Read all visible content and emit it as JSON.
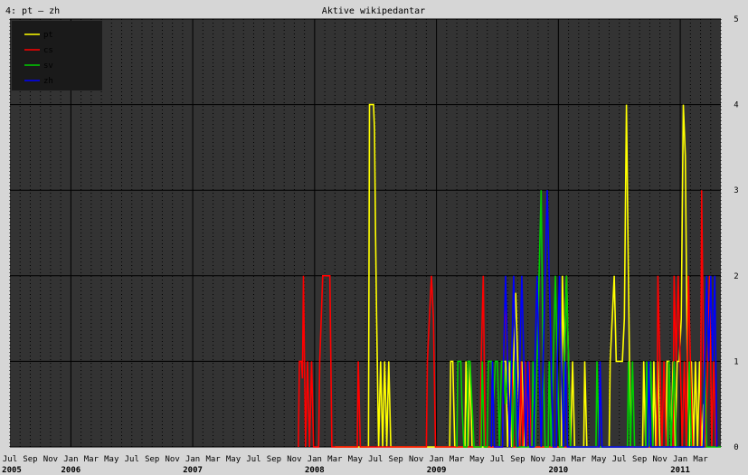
{
  "chart_data": {
    "type": "line",
    "title": "Aktive wikipedantar",
    "corner_label": "4: pt – zh",
    "ylim": [
      0,
      5
    ],
    "yticks": [
      "0",
      "1",
      "2",
      "3",
      "4",
      "5"
    ],
    "x_start": "2005-07",
    "month_ticks": [
      "Jul",
      "Sep",
      "Nov",
      "Jan",
      "Mar",
      "May",
      "Jul",
      "Sep",
      "Nov",
      "Jan",
      "Mar",
      "May",
      "Jul",
      "Sep",
      "Nov",
      "Jan",
      "Mar",
      "May",
      "Jul",
      "Sep",
      "Nov",
      "Jan",
      "Mar",
      "May",
      "Jul",
      "Sep",
      "Nov",
      "Jan",
      "Mar",
      "May",
      "Jul",
      "Sep",
      "Nov",
      "Jan",
      "Mar"
    ],
    "year_labels": [
      {
        "label": "2005",
        "month_index": 0
      },
      {
        "label": "2006",
        "month_index": 6
      },
      {
        "label": "2007",
        "month_index": 18
      },
      {
        "label": "2008",
        "month_index": 30
      },
      {
        "label": "2009",
        "month_index": 42
      },
      {
        "label": "2010",
        "month_index": 54
      },
      {
        "label": "2011",
        "month_index": 66
      }
    ],
    "x_months_span": 70,
    "grid": true,
    "legend_position": "top-left",
    "colors": {
      "background": "#333333",
      "grid": "#000000",
      "frame": "#d6d6d6"
    },
    "series": [
      {
        "name": "pt",
        "color": "#ffff00",
        "points": [
          [
            32.0,
            0
          ],
          [
            35.3,
            0
          ],
          [
            35.4,
            4
          ],
          [
            35.8,
            4
          ],
          [
            35.9,
            3.7
          ],
          [
            36.0,
            2.5
          ],
          [
            36.1,
            1.5
          ],
          [
            36.3,
            0
          ],
          [
            36.5,
            1
          ],
          [
            36.7,
            0
          ],
          [
            36.9,
            1
          ],
          [
            37.1,
            0
          ],
          [
            37.3,
            1
          ],
          [
            37.5,
            0
          ],
          [
            43.3,
            0
          ],
          [
            43.4,
            1
          ],
          [
            43.6,
            1
          ],
          [
            43.8,
            0
          ],
          [
            44.8,
            0
          ],
          [
            44.9,
            1
          ],
          [
            45.1,
            0
          ],
          [
            45.3,
            1
          ],
          [
            45.5,
            0
          ],
          [
            48.5,
            0
          ],
          [
            48.6,
            1
          ],
          [
            48.8,
            1
          ],
          [
            49.0,
            0
          ],
          [
            49.2,
            1
          ],
          [
            49.4,
            0
          ],
          [
            49.6,
            1
          ],
          [
            49.8,
            1.8
          ],
          [
            50.0,
            1
          ],
          [
            50.2,
            0
          ],
          [
            50.4,
            1
          ],
          [
            50.6,
            0
          ],
          [
            54.3,
            0
          ],
          [
            54.4,
            2
          ],
          [
            54.6,
            1
          ],
          [
            54.8,
            2
          ],
          [
            55.0,
            1
          ],
          [
            55.2,
            0
          ],
          [
            55.4,
            1
          ],
          [
            55.6,
            0
          ],
          [
            56.5,
            0
          ],
          [
            56.6,
            1
          ],
          [
            56.8,
            0
          ],
          [
            59.0,
            0
          ],
          [
            59.1,
            1
          ],
          [
            59.3,
            1.5
          ],
          [
            59.5,
            2
          ],
          [
            59.7,
            1
          ],
          [
            59.9,
            1
          ],
          [
            60.1,
            1
          ],
          [
            60.3,
            1
          ],
          [
            60.5,
            1.5
          ],
          [
            60.7,
            4
          ],
          [
            60.9,
            2
          ],
          [
            61.1,
            0
          ],
          [
            62.3,
            0
          ],
          [
            62.4,
            1
          ],
          [
            62.6,
            0
          ],
          [
            63.3,
            0
          ],
          [
            63.4,
            1
          ],
          [
            63.6,
            0
          ],
          [
            63.8,
            1
          ],
          [
            64.0,
            0
          ],
          [
            64.6,
            0
          ],
          [
            64.7,
            1
          ],
          [
            64.9,
            1
          ],
          [
            65.1,
            0
          ],
          [
            65.3,
            1
          ],
          [
            65.5,
            0
          ],
          [
            65.7,
            1
          ],
          [
            65.9,
            1
          ],
          [
            66.1,
            1.5
          ],
          [
            66.3,
            4
          ],
          [
            66.5,
            3.4
          ],
          [
            66.7,
            1
          ],
          [
            66.9,
            0
          ],
          [
            67.1,
            1
          ],
          [
            67.3,
            0
          ],
          [
            67.5,
            1
          ],
          [
            67.7,
            0
          ],
          [
            67.9,
            1
          ],
          [
            68.1,
            0
          ],
          [
            68.3,
            0.5
          ],
          [
            68.5,
            0
          ]
        ]
      },
      {
        "name": "cs",
        "color": "#ff0000",
        "points": [
          [
            28.4,
            0
          ],
          [
            28.5,
            1
          ],
          [
            28.7,
            1
          ],
          [
            28.8,
            0.8
          ],
          [
            28.9,
            2
          ],
          [
            29.1,
            0
          ],
          [
            29.3,
            1
          ],
          [
            29.5,
            0
          ],
          [
            29.7,
            1
          ],
          [
            29.9,
            0
          ],
          [
            30.4,
            0
          ],
          [
            30.5,
            1
          ],
          [
            30.8,
            2
          ],
          [
            31.5,
            2
          ],
          [
            31.6,
            1
          ],
          [
            31.7,
            0
          ],
          [
            34.2,
            0
          ],
          [
            34.3,
            1
          ],
          [
            34.5,
            0
          ],
          [
            41.0,
            0
          ],
          [
            41.1,
            1
          ],
          [
            41.3,
            1.5
          ],
          [
            41.5,
            2
          ],
          [
            41.7,
            1.5
          ],
          [
            41.9,
            0
          ],
          [
            46.3,
            0
          ],
          [
            46.4,
            1
          ],
          [
            46.6,
            2
          ],
          [
            46.8,
            0
          ],
          [
            47.0,
            0
          ],
          [
            48.5,
            0
          ],
          [
            48.6,
            1
          ],
          [
            48.8,
            1.8
          ],
          [
            49.0,
            1
          ],
          [
            49.2,
            0
          ],
          [
            49.4,
            1
          ],
          [
            49.6,
            0
          ],
          [
            50.2,
            0
          ],
          [
            50.3,
            1
          ],
          [
            50.5,
            0
          ],
          [
            50.7,
            1
          ],
          [
            50.9,
            0
          ],
          [
            51.1,
            1
          ],
          [
            51.3,
            0
          ],
          [
            63.7,
            0
          ],
          [
            63.8,
            2
          ],
          [
            64.0,
            1
          ],
          [
            64.2,
            0
          ],
          [
            64.4,
            1
          ],
          [
            64.6,
            0
          ],
          [
            65.3,
            0
          ],
          [
            65.4,
            2
          ],
          [
            65.6,
            1
          ],
          [
            65.8,
            2
          ],
          [
            66.0,
            1
          ],
          [
            66.2,
            0
          ],
          [
            66.4,
            1
          ],
          [
            66.6,
            0
          ],
          [
            66.8,
            2
          ],
          [
            67.0,
            1
          ],
          [
            67.2,
            0
          ],
          [
            68.0,
            0
          ],
          [
            68.1,
            3
          ],
          [
            68.3,
            1
          ],
          [
            68.5,
            0
          ],
          [
            68.7,
            1
          ],
          [
            68.9,
            2
          ],
          [
            69.1,
            0
          ],
          [
            69.3,
            1
          ],
          [
            69.5,
            0
          ]
        ]
      },
      {
        "name": "sv",
        "color": "#00cc00",
        "points": [
          [
            44.0,
            0
          ],
          [
            44.1,
            1
          ],
          [
            44.4,
            1
          ],
          [
            44.5,
            0.5
          ],
          [
            44.7,
            0
          ],
          [
            45.0,
            0
          ],
          [
            45.1,
            1
          ],
          [
            45.3,
            1
          ],
          [
            45.5,
            0.5
          ],
          [
            45.7,
            0
          ],
          [
            46.4,
            0
          ],
          [
            46.5,
            1
          ],
          [
            46.7,
            0
          ],
          [
            47.0,
            0
          ],
          [
            47.1,
            1
          ],
          [
            47.4,
            1
          ],
          [
            47.6,
            0.5
          ],
          [
            47.8,
            1
          ],
          [
            48.0,
            1
          ],
          [
            48.2,
            0
          ],
          [
            48.4,
            1
          ],
          [
            48.6,
            1
          ],
          [
            48.8,
            0.5
          ],
          [
            49.0,
            1
          ],
          [
            49.3,
            1
          ],
          [
            49.5,
            0
          ],
          [
            49.7,
            1
          ],
          [
            49.9,
            0
          ],
          [
            51.4,
            0
          ],
          [
            51.5,
            1
          ],
          [
            51.7,
            0
          ],
          [
            51.9,
            1
          ],
          [
            52.1,
            2
          ],
          [
            52.3,
            3
          ],
          [
            52.5,
            1
          ],
          [
            52.7,
            0
          ],
          [
            53.0,
            0
          ],
          [
            53.1,
            1
          ],
          [
            53.3,
            0
          ],
          [
            53.5,
            1
          ],
          [
            53.7,
            2
          ],
          [
            53.9,
            1
          ],
          [
            54.1,
            0
          ],
          [
            54.5,
            0
          ],
          [
            54.6,
            1
          ],
          [
            54.8,
            2
          ],
          [
            55.0,
            1
          ],
          [
            55.2,
            0
          ],
          [
            57.7,
            0
          ],
          [
            57.8,
            1
          ],
          [
            58.0,
            0
          ],
          [
            60.8,
            0
          ],
          [
            60.9,
            1
          ],
          [
            61.1,
            0
          ],
          [
            61.3,
            1
          ],
          [
            61.5,
            0
          ],
          [
            62.6,
            0
          ],
          [
            62.7,
            1
          ],
          [
            62.9,
            0
          ],
          [
            63.1,
            1
          ],
          [
            63.3,
            0
          ],
          [
            64.8,
            0
          ],
          [
            64.9,
            1
          ],
          [
            65.1,
            0
          ],
          [
            65.4,
            1
          ],
          [
            65.6,
            0
          ],
          [
            66.8,
            0
          ],
          [
            66.9,
            1
          ],
          [
            67.1,
            0
          ],
          [
            68.3,
            0
          ],
          [
            68.4,
            1
          ],
          [
            68.6,
            0
          ],
          [
            70.0,
            0
          ]
        ]
      },
      {
        "name": "zh",
        "color": "#0000ff",
        "points": [
          [
            47.4,
            0
          ],
          [
            47.5,
            1
          ],
          [
            47.7,
            0
          ],
          [
            48.5,
            0
          ],
          [
            48.6,
            1
          ],
          [
            48.8,
            2
          ],
          [
            49.0,
            1
          ],
          [
            49.2,
            0
          ],
          [
            49.4,
            1
          ],
          [
            49.6,
            2
          ],
          [
            49.8,
            1
          ],
          [
            50.0,
            0
          ],
          [
            50.2,
            1
          ],
          [
            50.4,
            2
          ],
          [
            50.6,
            1
          ],
          [
            50.8,
            0
          ],
          [
            51.0,
            1
          ],
          [
            51.2,
            0
          ],
          [
            51.6,
            0
          ],
          [
            51.7,
            1
          ],
          [
            51.9,
            2
          ],
          [
            52.1,
            1
          ],
          [
            52.3,
            0
          ],
          [
            52.5,
            1
          ],
          [
            52.7,
            2
          ],
          [
            52.9,
            3
          ],
          [
            53.1,
            2
          ],
          [
            53.3,
            1
          ],
          [
            53.5,
            0
          ],
          [
            53.8,
            0
          ],
          [
            53.9,
            1
          ],
          [
            54.1,
            2
          ],
          [
            54.3,
            1
          ],
          [
            54.5,
            0
          ],
          [
            54.7,
            1
          ],
          [
            54.9,
            0
          ],
          [
            58.0,
            0
          ],
          [
            58.1,
            1
          ],
          [
            58.3,
            0
          ],
          [
            62.8,
            0
          ],
          [
            62.9,
            1
          ],
          [
            63.1,
            0
          ],
          [
            68.3,
            0
          ],
          [
            68.4,
            1
          ],
          [
            68.6,
            2
          ],
          [
            68.8,
            1
          ],
          [
            69.0,
            2
          ],
          [
            69.2,
            1
          ],
          [
            69.4,
            2
          ],
          [
            69.6,
            0
          ]
        ]
      }
    ]
  }
}
